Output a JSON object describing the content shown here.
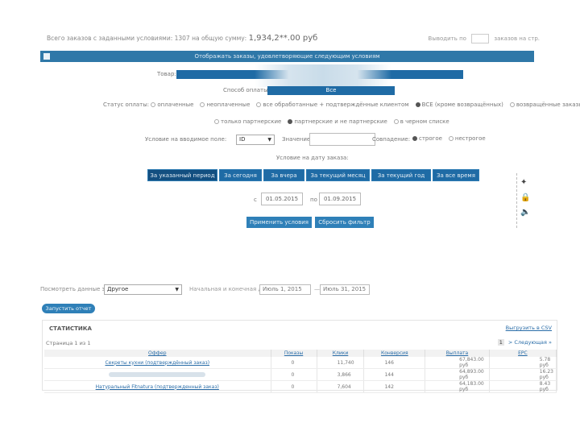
{
  "summary": {
    "text": "Всего заказов с заданными условиями: 1307 на общую сумму:",
    "amount": "1,934,2**.00 руб"
  },
  "perpage": {
    "label_left": "Выводить по",
    "label_right": "заказов на стр."
  },
  "panel": {
    "header": "Отображать заказы, удовлетворяющие следующим условиям",
    "product_label": "Товар:",
    "product_value": "",
    "source_label": "Способ оплаты:",
    "source_value": "Все",
    "status_label": "Статус оплаты:",
    "status_options": [
      {
        "label": "оплаченные",
        "checked": false
      },
      {
        "label": "неоплаченные",
        "checked": false
      },
      {
        "label": "все обработанные + подтверждённые клиентом",
        "checked": false
      },
      {
        "label": "ВСЕ (кроме возвращённых)",
        "checked": true
      },
      {
        "label": "возвращённые заказы",
        "checked": false
      }
    ],
    "partner_options": [
      {
        "label": "только партнерские",
        "checked": false
      },
      {
        "label": "партнерские и не партнерские",
        "checked": true
      },
      {
        "label": "в черном списке",
        "checked": false
      }
    ],
    "field_label": "Условие на вводимое поле:",
    "field_value": "ID",
    "value_label": "Значение:",
    "match_label": "Совпадение:",
    "match_options": [
      {
        "label": "строгое",
        "checked": true
      },
      {
        "label": "нестрогое",
        "checked": false
      }
    ],
    "date_condition": "Условие на дату заказа:",
    "periods": [
      {
        "label": "За указанный период",
        "active": true
      },
      {
        "label": "За сегодня",
        "active": false
      },
      {
        "label": "За вчера",
        "active": false
      },
      {
        "label": "За текущий месяц",
        "active": false
      },
      {
        "label": "За текущий год",
        "active": false
      },
      {
        "label": "За все время",
        "active": false
      }
    ],
    "from_label": "с",
    "date_from": "01.05.2015",
    "to_label": "по",
    "date_to": "01.09.2015",
    "apply_button": "Применить условия",
    "reset_button": "Сбросить фильтр"
  },
  "side_icons": [
    "star-icon",
    "lock-icon",
    "speaker-icon"
  ],
  "stats_filter": {
    "view_label": "Посмотреть данные за:",
    "view_value": "Другое",
    "custom_label": "Начальная и конечная даты:",
    "date_from": "Июль 1, 2015",
    "date_sep": "—",
    "date_to": "Июль 31, 2015",
    "submit": "Запустить отчет"
  },
  "stats": {
    "title": "СТАТИСТИКА",
    "export": "Выгрузить в CSV",
    "page_label": "Страница 1 из 1",
    "pager_current": "1",
    "pager_next": "> Следующая »",
    "columns": [
      "Оффер",
      "Показы",
      "Клики",
      "Конверсия",
      "Выплата",
      "EPC"
    ],
    "rows": [
      {
        "offer": "Секреты кухни (подтверждённый заказ)",
        "blurred": false,
        "shows": "0",
        "clicks": "11,740",
        "conv": "146",
        "payout": "67,843.00 руб",
        "epc": "5.78 руб"
      },
      {
        "offer": "",
        "blurred": true,
        "shows": "0",
        "clicks": "3,866",
        "conv": "144",
        "payout": "64,893.00 руб",
        "epc": "16.23 руб"
      },
      {
        "offer": "Натуральный Fitnatura (подтвержденный заказ)",
        "blurred": false,
        "shows": "0",
        "clicks": "7,604",
        "conv": "142",
        "payout": "64,183.00 руб",
        "epc": "8.43 руб"
      }
    ]
  },
  "colors": {
    "primary": "#2f78a8",
    "dark": "#1f6ba5",
    "link": "#2a6da8"
  }
}
